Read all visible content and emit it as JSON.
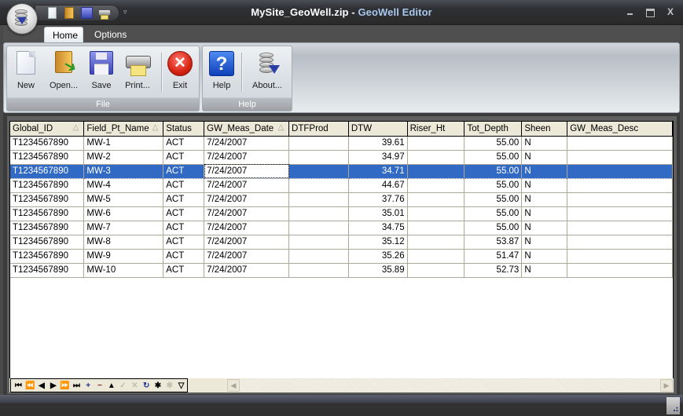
{
  "window": {
    "file_name": "MySite_GeoWell.zip",
    "separator": " - ",
    "app_name": "GeoWell Editor",
    "close_glyph": "X"
  },
  "quick_access": {
    "items": [
      "new-icon",
      "open-icon",
      "save-icon",
      "print-icon"
    ],
    "dropdown_glyph": "▿"
  },
  "ribbon": {
    "tabs": [
      {
        "label": "Home",
        "active": true
      },
      {
        "label": "Options",
        "active": false
      }
    ],
    "groups": [
      {
        "label": "File",
        "buttons": [
          {
            "label": "New",
            "icon": "new-document-icon"
          },
          {
            "label": "Open...",
            "icon": "open-folder-icon"
          },
          {
            "label": "Save",
            "icon": "floppy-disk-icon"
          },
          {
            "label": "Print...",
            "icon": "printer-icon"
          },
          {
            "label": "Exit",
            "icon": "exit-icon"
          }
        ]
      },
      {
        "label": "Help",
        "buttons": [
          {
            "label": "Help",
            "icon": "help-icon"
          },
          {
            "label": "About...",
            "icon": "database-icon"
          }
        ]
      }
    ]
  },
  "grid": {
    "columns": [
      {
        "label": "Global_ID",
        "sort": "△"
      },
      {
        "label": "Field_Pt_Name",
        "sort": "△"
      },
      {
        "label": "Status",
        "sort": ""
      },
      {
        "label": "GW_Meas_Date",
        "sort": "△"
      },
      {
        "label": "DTFProd",
        "sort": ""
      },
      {
        "label": "DTW",
        "sort": ""
      },
      {
        "label": "Riser_Ht",
        "sort": ""
      },
      {
        "label": "Tot_Depth",
        "sort": ""
      },
      {
        "label": "Sheen",
        "sort": ""
      },
      {
        "label": "GW_Meas_Desc",
        "sort": ""
      }
    ],
    "selected_row": 2,
    "focused_column": 3,
    "rows": [
      [
        "T1234567890",
        "MW-1",
        "ACT",
        "7/24/2007",
        "",
        "39.61",
        "",
        "55.00",
        "N",
        ""
      ],
      [
        "T1234567890",
        "MW-2",
        "ACT",
        "7/24/2007",
        "",
        "34.97",
        "",
        "55.00",
        "N",
        ""
      ],
      [
        "T1234567890",
        "MW-3",
        "ACT",
        "7/24/2007",
        "",
        "34.71",
        "",
        "55.00",
        "N",
        ""
      ],
      [
        "T1234567890",
        "MW-4",
        "ACT",
        "7/24/2007",
        "",
        "44.67",
        "",
        "55.00",
        "N",
        ""
      ],
      [
        "T1234567890",
        "MW-5",
        "ACT",
        "7/24/2007",
        "",
        "37.76",
        "",
        "55.00",
        "N",
        ""
      ],
      [
        "T1234567890",
        "MW-6",
        "ACT",
        "7/24/2007",
        "",
        "35.01",
        "",
        "55.00",
        "N",
        ""
      ],
      [
        "T1234567890",
        "MW-7",
        "ACT",
        "7/24/2007",
        "",
        "34.75",
        "",
        "55.00",
        "N",
        ""
      ],
      [
        "T1234567890",
        "MW-8",
        "ACT",
        "7/24/2007",
        "",
        "35.12",
        "",
        "53.87",
        "N",
        ""
      ],
      [
        "T1234567890",
        "MW-9",
        "ACT",
        "7/24/2007",
        "",
        "35.26",
        "",
        "51.47",
        "N",
        ""
      ],
      [
        "T1234567890",
        "MW-10",
        "ACT",
        "7/24/2007",
        "",
        "35.89",
        "",
        "52.73",
        "N",
        ""
      ]
    ]
  },
  "navigator": {
    "buttons": [
      {
        "name": "first-record",
        "glyph": "⏮",
        "style": ""
      },
      {
        "name": "previous-page",
        "glyph": "⏪",
        "style": ""
      },
      {
        "name": "previous-record",
        "glyph": "◀",
        "style": ""
      },
      {
        "name": "next-record",
        "glyph": "▶",
        "style": ""
      },
      {
        "name": "next-page",
        "glyph": "⏩",
        "style": ""
      },
      {
        "name": "last-record",
        "glyph": "⏭",
        "style": ""
      },
      {
        "name": "insert-record",
        "glyph": "+",
        "style": "blue"
      },
      {
        "name": "delete-record",
        "glyph": "−",
        "style": "red"
      },
      {
        "name": "edit-record",
        "glyph": "▲",
        "style": ""
      },
      {
        "name": "post-edit",
        "glyph": "✓",
        "style": "dis"
      },
      {
        "name": "cancel-edit",
        "glyph": "✕",
        "style": "dis"
      },
      {
        "name": "refresh-records",
        "glyph": "↻",
        "style": "blue"
      },
      {
        "name": "set-bookmark",
        "glyph": "✱",
        "style": ""
      },
      {
        "name": "goto-bookmark",
        "glyph": "✱",
        "style": "dis"
      },
      {
        "name": "filter",
        "glyph": "▽",
        "style": ""
      }
    ],
    "scroll_left_glyph": "◀",
    "scroll_right_glyph": "▶"
  }
}
